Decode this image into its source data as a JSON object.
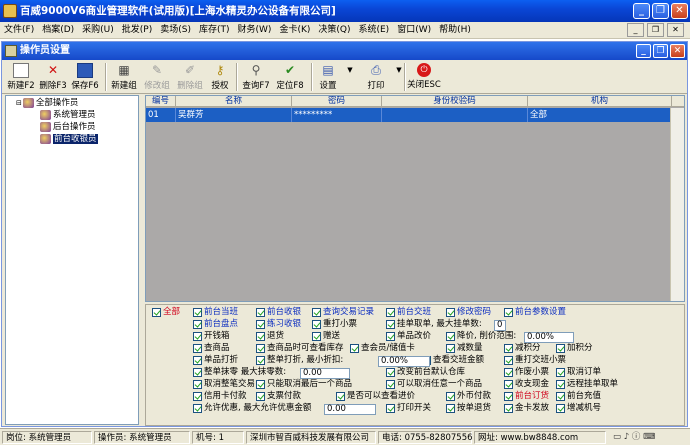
{
  "app": {
    "title": "百威9000V6商业管理软件(试用版)[上海水精灵办公设备有限公司]"
  },
  "window_controls": {
    "minimize": "_",
    "restore": "❐",
    "close": "✕"
  },
  "menu": [
    "文件(F)",
    "档案(D)",
    "采购(U)",
    "批发(P)",
    "卖场(S)",
    "库存(T)",
    "财务(W)",
    "金卡(K)",
    "决策(Q)",
    "系统(E)",
    "窗口(W)",
    "帮助(H)"
  ],
  "inner_window": {
    "title": "操作员设置"
  },
  "toolbar": {
    "new": "新建F2",
    "delete": "删除F3",
    "save": "保存F6",
    "new_group": "新建组",
    "edit_group": "修改组",
    "delete_group": "删除组",
    "authorize": "授权",
    "query": "查询F7",
    "locate": "定位F8",
    "settings": "设置",
    "print": "打印",
    "close": "关闭ESC"
  },
  "tree": {
    "root": "全部操作员",
    "children": [
      "系统管理员",
      "后台操作员",
      "前台收银员"
    ]
  },
  "grid": {
    "columns": [
      "编号",
      "名称",
      "密码",
      "身份校验码",
      "机构"
    ],
    "rows": [
      {
        "id": "01",
        "name": "吴群芳",
        "password": "*********",
        "verify": "",
        "org": "全部"
      }
    ]
  },
  "permissions": {
    "all": "全部",
    "items": [
      {
        "label": "前台当班",
        "color": "blue"
      },
      {
        "label": "前台收银",
        "color": "blue"
      },
      {
        "label": "查询交易记录",
        "color": "blue"
      },
      {
        "label": "前台交班",
        "color": "blue"
      },
      {
        "label": "修改密码",
        "color": "blue"
      },
      {
        "label": "前台参数设置",
        "color": "blue"
      },
      {
        "label": "前台盘点",
        "color": "blue"
      },
      {
        "label": "练习收银",
        "color": "blue"
      },
      {
        "label": "重打小票",
        "color": "black"
      },
      {
        "label": "挂单取单, 最大挂单数:",
        "color": "black"
      },
      {
        "label": "开钱箱",
        "color": "black"
      },
      {
        "label": "退货",
        "color": "black"
      },
      {
        "label": "赠送",
        "color": "black"
      },
      {
        "label": "单品改价",
        "color": "black"
      },
      {
        "label": "降价, 削价范围:",
        "color": "black"
      },
      {
        "label": "查商品",
        "color": "black"
      },
      {
        "label": "查商品时可查看库存",
        "color": "black"
      },
      {
        "label": "查会员/储值卡",
        "color": "black"
      },
      {
        "label": "减数量",
        "color": "black"
      },
      {
        "label": "减积分",
        "color": "black"
      },
      {
        "label": "加积分",
        "color": "black"
      },
      {
        "label": "单品打折",
        "color": "black"
      },
      {
        "label": "整单打折, 最小折扣:",
        "color": "black"
      },
      {
        "label": "查看交班金额",
        "color": "black"
      },
      {
        "label": "重打交班小票",
        "color": "black"
      },
      {
        "label": "整单抹零  最大抹零数:",
        "color": "black"
      },
      {
        "label": "改变前台默认仓库",
        "color": "black"
      },
      {
        "label": "作废小票",
        "color": "black"
      },
      {
        "label": "取消订单",
        "color": "black"
      },
      {
        "label": "取消整笔交易",
        "color": "black"
      },
      {
        "label": "只能取消最后一个商品",
        "color": "black"
      },
      {
        "label": "可以取消任意一个商品",
        "color": "black"
      },
      {
        "label": "收支现金",
        "color": "black"
      },
      {
        "label": "远程挂单取单",
        "color": "black"
      },
      {
        "label": "信用卡付款",
        "color": "black"
      },
      {
        "label": "支票付款",
        "color": "black"
      },
      {
        "label": "是否可以查看进价",
        "color": "black"
      },
      {
        "label": "外币付款",
        "color": "black"
      },
      {
        "label": "前台订货",
        "color": "red"
      },
      {
        "label": "前台充值",
        "color": "black"
      },
      {
        "label": "允许优惠, 最大允许优惠金额",
        "color": "black"
      },
      {
        "label": "打印开关",
        "color": "black"
      },
      {
        "label": "按单退货",
        "color": "black"
      },
      {
        "label": "金卡发放",
        "color": "black"
      },
      {
        "label": "增减机号",
        "color": "black"
      }
    ],
    "max_hang": "0",
    "price_range": "0.00%",
    "min_discount": "0.00%",
    "max_round": "0.00",
    "max_discount_amount": "0.00"
  },
  "status": {
    "post": "岗位: 系统管理员",
    "operator": "操作员: 系统管理员",
    "machine": "机号: 1",
    "company": "深圳市智百威科技发展有限公司",
    "phone": "电话: 0755-82807556",
    "website": "网址: www.bw8848.com"
  },
  "colors": {
    "selection": "#1c5fc4",
    "title": "#0a46d6",
    "red": "#d0001a",
    "blue": "#0a2cc0"
  }
}
